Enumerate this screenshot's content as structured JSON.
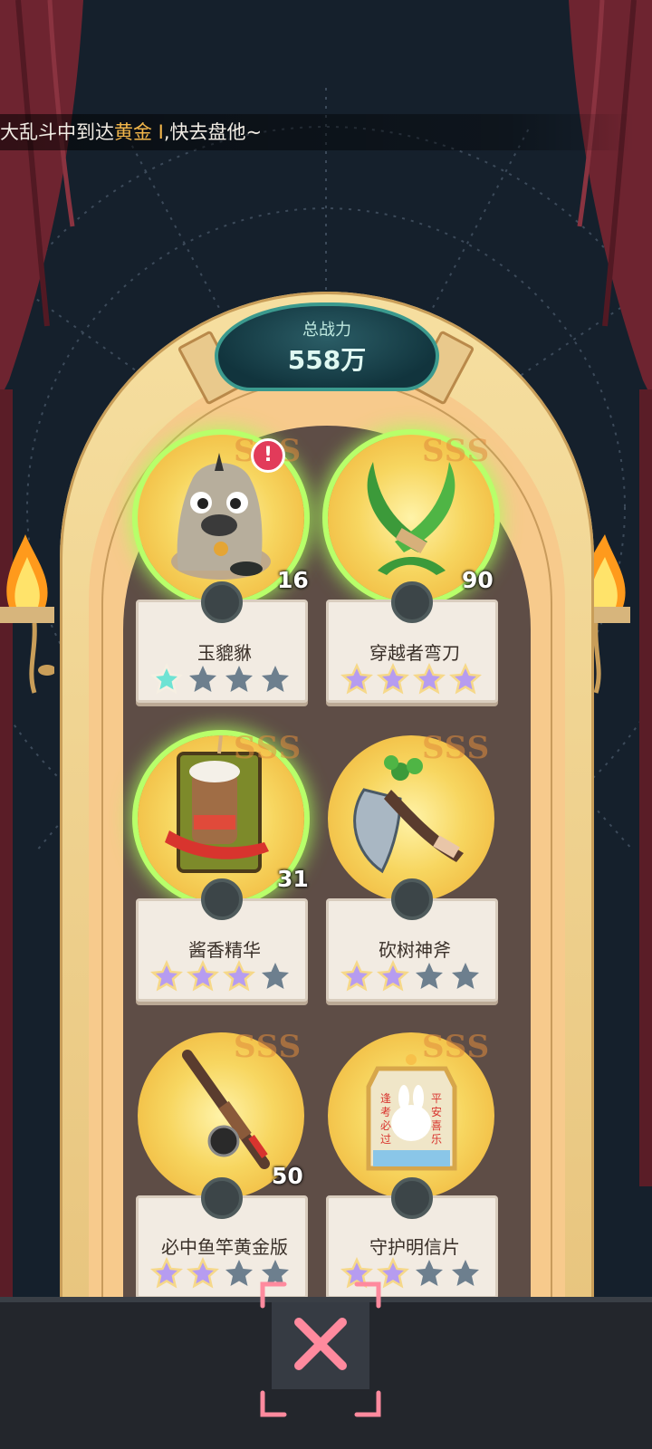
{
  "ticker": {
    "text_before": "大乱斗中到达",
    "text_highlight": "黄金 I",
    "text_after": ",快去盘他~"
  },
  "total_power": {
    "label": "总战力",
    "value": "558万"
  },
  "items": [
    {
      "name": "玉貔貅",
      "grade": "SSS",
      "count": "16",
      "stars_filled": 1,
      "stars_total": 4,
      "star_color": "teal",
      "has_alert": true,
      "glow": true,
      "icon": "pixiu-statue-icon"
    },
    {
      "name": "穿越者弯刀",
      "grade": "SSS",
      "count": "90",
      "stars_filled": 4,
      "stars_total": 4,
      "star_color": "purple",
      "has_alert": false,
      "glow": true,
      "icon": "crossed-green-blades-icon"
    },
    {
      "name": "酱香精华",
      "grade": "SSS",
      "count": "31",
      "stars_filled": 3,
      "stars_total": 4,
      "star_color": "purple",
      "has_alert": false,
      "glow": true,
      "icon": "coffee-drink-box-icon"
    },
    {
      "name": "砍树神斧",
      "grade": "SSS",
      "count": "",
      "stars_filled": 2,
      "stars_total": 4,
      "star_color": "purple",
      "has_alert": false,
      "glow": false,
      "icon": "leafy-axe-icon"
    },
    {
      "name": "必中鱼竿黄金版",
      "grade": "SSS",
      "count": "50",
      "stars_filled": 2,
      "stars_total": 4,
      "star_color": "purple",
      "has_alert": false,
      "glow": false,
      "icon": "fishing-rod-icon"
    },
    {
      "name": "守护明信片",
      "grade": "SSS",
      "count": "",
      "stars_filled": 2,
      "stars_total": 4,
      "star_color": "purple",
      "has_alert": false,
      "glow": false,
      "icon": "bunny-charm-card-icon"
    }
  ],
  "charm_text": {
    "left": "逢考必过",
    "right": "平安喜乐"
  },
  "alert_symbol": "!",
  "colors": {
    "background": "#15202c",
    "curtain": "#6e2430",
    "power_teal": "#3b9a8e",
    "glow_green": "#b8ff6a",
    "star_purple": "#b69cf0",
    "star_teal": "#6ee3d4",
    "star_empty": "#6d7f8e",
    "close_pink": "#ff8a9e"
  },
  "close_button": {
    "icon": "close-x-icon"
  }
}
